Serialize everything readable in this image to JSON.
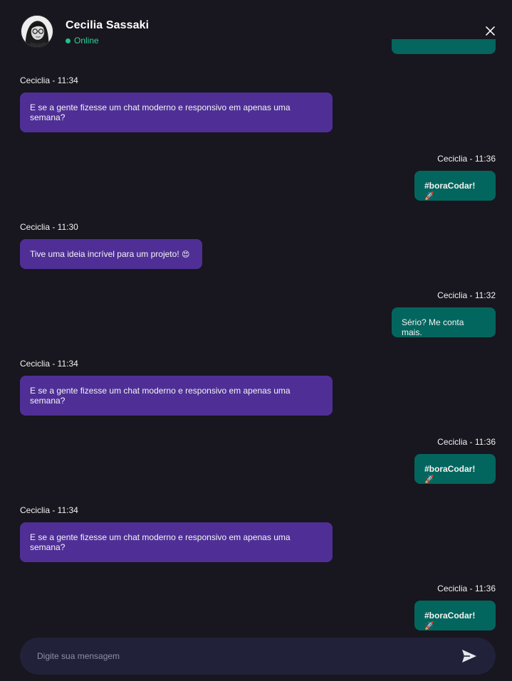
{
  "header": {
    "contact_name": "Cecilia Sassaki",
    "status": "Online",
    "avatar_icon": "avatar-woman-glasses",
    "close_icon": "close-icon"
  },
  "messages": [
    {
      "direction": "in",
      "meta": "Ceciclia - 11:34",
      "text": "E se a gente fizesse um chat moderno e responsivo em apenas uma semana?"
    },
    {
      "direction": "out",
      "meta": "Ceciclia - 11:36",
      "text": "#boraCodar!",
      "emoji": "🚀"
    },
    {
      "direction": "in",
      "meta": "Ceciclia - 11:30",
      "text": "Tive uma ideia incrível para um projeto!",
      "emoji": "😍"
    },
    {
      "direction": "out",
      "meta": "Ceciclia - 11:32",
      "text": "Sério? Me conta mais."
    },
    {
      "direction": "in",
      "meta": "Ceciclia - 11:34",
      "text": "E se a gente fizesse um chat moderno e responsivo em apenas uma semana?"
    },
    {
      "direction": "out",
      "meta": "Ceciclia - 11:36",
      "text": "#boraCodar!",
      "emoji": "🚀"
    },
    {
      "direction": "in",
      "meta": "Ceciclia - 11:34",
      "text": "E se a gente fizesse um chat moderno e responsivo em apenas uma semana?"
    },
    {
      "direction": "out",
      "meta": "Ceciclia - 11:36",
      "text": "#boraCodar!",
      "emoji": "🚀"
    }
  ],
  "composer": {
    "placeholder": "Digite sua mensagem",
    "value": "",
    "send_icon": "send-icon"
  },
  "colors": {
    "background": "#18161e",
    "incoming_bubble": "#4f2f96",
    "outgoing_bubble": "#03665e",
    "online": "#1ec28b",
    "composer": "#21223a"
  }
}
